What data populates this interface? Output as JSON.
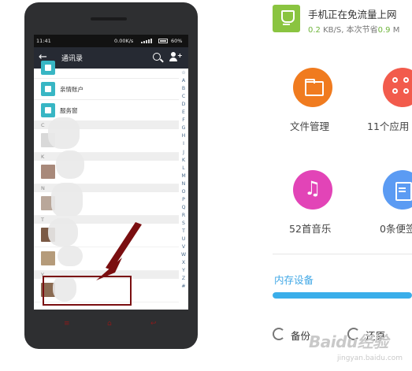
{
  "phone": {
    "status": {
      "time": "11:41",
      "speed": "0.00K/s",
      "battery": "60%"
    },
    "header": {
      "title": "通讯录",
      "back_icon": "arrow-left-icon",
      "search_icon": "search-icon",
      "add_icon": "add-contact-icon"
    },
    "items": [
      {
        "label": "亲情账户",
        "icon": "home-icon"
      },
      {
        "label": "服务窗",
        "icon": "bookmark-icon"
      }
    ],
    "sections": [
      "C",
      "K",
      "N",
      "T",
      "Y"
    ],
    "index_letters": [
      "☆",
      "A",
      "B",
      "C",
      "D",
      "E",
      "F",
      "G",
      "H",
      "I",
      "J",
      "K",
      "L",
      "M",
      "N",
      "O",
      "P",
      "Q",
      "R",
      "S",
      "T",
      "U",
      "V",
      "W",
      "X",
      "Y",
      "Z",
      "#"
    ],
    "nav": {
      "menu": "≡",
      "home": "⌂",
      "back": "↩"
    }
  },
  "notification": {
    "title": "手机正在免流量上网",
    "speed_value": "0.2",
    "speed_unit": "KB/S,",
    "saved_text": "本次节省",
    "saved_value": "0.9",
    "saved_unit": "M"
  },
  "tiles": [
    {
      "label": "文件管理",
      "icon": "folder-icon",
      "color": "#f07b1f"
    },
    {
      "label": "11个应用",
      "icon": "apps-icon",
      "color": "#f25b4c"
    },
    {
      "label": "52首音乐",
      "icon": "music-icon",
      "color": "#e244b7"
    },
    {
      "label": "0条便签",
      "icon": "notes-icon",
      "color": "#5b9bf3"
    }
  ],
  "storage": {
    "label": "内存设备",
    "fill_fraction": 1.0
  },
  "actions": {
    "backup": "备份",
    "restore": "还原"
  },
  "watermark": {
    "brand": "Baidu经验",
    "url": "jingyan.baidu.com"
  }
}
